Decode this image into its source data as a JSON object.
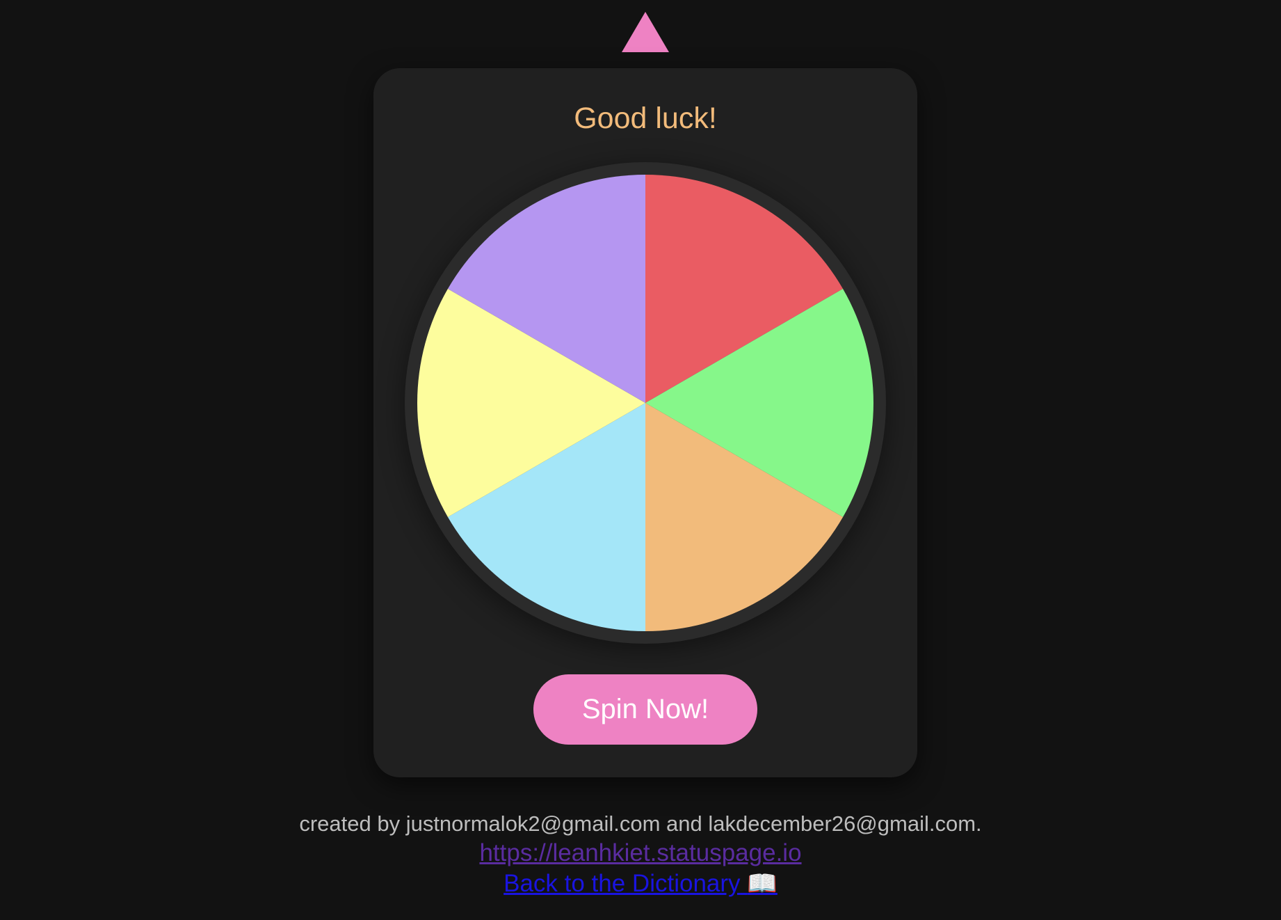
{
  "title": "Good luck!",
  "spin_button_label": "Spin Now!",
  "pointer": {
    "icon": "triangle-pointer-icon",
    "color": "#ee82c3"
  },
  "wheel": {
    "rim_color": "#2b2b2b",
    "segments": [
      {
        "color": "#ea5c63"
      },
      {
        "color": "#86f78a"
      },
      {
        "color": "#f2bb7b"
      },
      {
        "color": "#a4e6f8"
      },
      {
        "color": "#fdfd9d"
      },
      {
        "color": "#b596f1"
      }
    ]
  },
  "footer": {
    "credit": "created by justnormalok2@gmail.com and lakdecember26@gmail.com.",
    "status_link": "https://leanhkiet.statuspage.io",
    "dictionary_link": "Back to the Dictionary",
    "dictionary_icon": "📖"
  }
}
